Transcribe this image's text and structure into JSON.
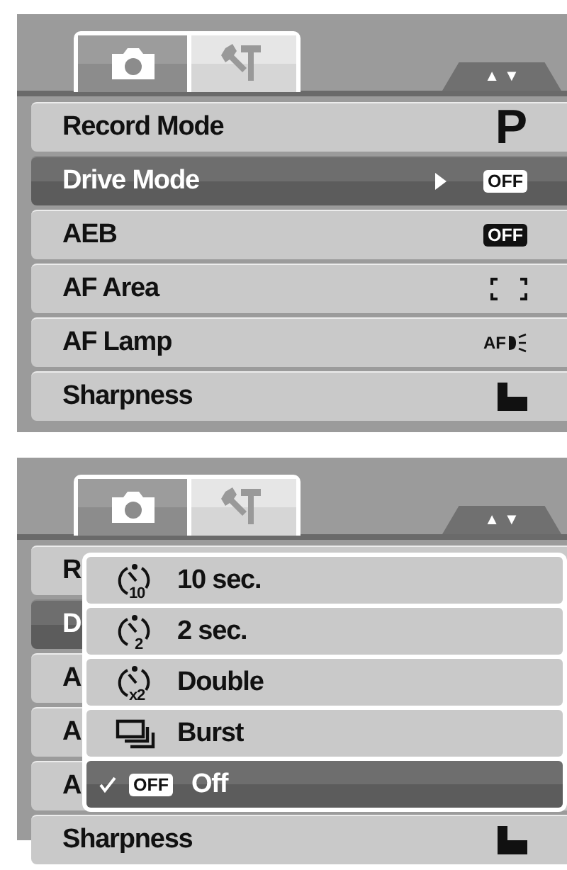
{
  "screens": [
    {
      "tabs": [
        {
          "selected": true
        },
        {
          "selected": false
        }
      ],
      "scroll_arrows": "▲ ▼",
      "rows": [
        {
          "label": "Record Mode",
          "kind": "text",
          "value": "P",
          "selected": false
        },
        {
          "label": "Drive Mode",
          "kind": "badge",
          "value": "OFF",
          "submenu": true,
          "selected": true
        },
        {
          "label": "AEB",
          "kind": "badge",
          "value": "OFF",
          "selected": false
        },
        {
          "label": "AF Area",
          "kind": "af-area",
          "selected": false
        },
        {
          "label": "AF Lamp",
          "kind": "lamp",
          "value": "AF",
          "selected": false
        },
        {
          "label": "Sharpness",
          "kind": "sharpness",
          "selected": false
        }
      ]
    },
    {
      "tabs": [
        {
          "selected": true
        },
        {
          "selected": false
        }
      ],
      "scroll_arrows": "▲ ▼",
      "rows": [
        {
          "label": "R",
          "kind": "none",
          "selected": false
        },
        {
          "label": "D",
          "kind": "none",
          "selected": true
        },
        {
          "label": "A",
          "kind": "none",
          "selected": false
        },
        {
          "label": "A",
          "kind": "none",
          "selected": false
        },
        {
          "label": "A",
          "kind": "none",
          "selected": false
        },
        {
          "label": "Sharpness",
          "kind": "sharpness",
          "selected": false
        }
      ],
      "popup": {
        "items": [
          {
            "label": "10 sec.",
            "kind": "timer",
            "icon_text": "10",
            "checked": false,
            "selected": false
          },
          {
            "label": "2 sec.",
            "kind": "timer",
            "icon_text": "2",
            "checked": false,
            "selected": false
          },
          {
            "label": "Double",
            "kind": "timer",
            "icon_text": "x2",
            "checked": false,
            "selected": false
          },
          {
            "label": "Burst",
            "kind": "burst",
            "checked": false,
            "selected": false
          },
          {
            "label": "Off",
            "kind": "badge",
            "badge": "OFF",
            "checked": true,
            "selected": true
          }
        ]
      }
    }
  ]
}
